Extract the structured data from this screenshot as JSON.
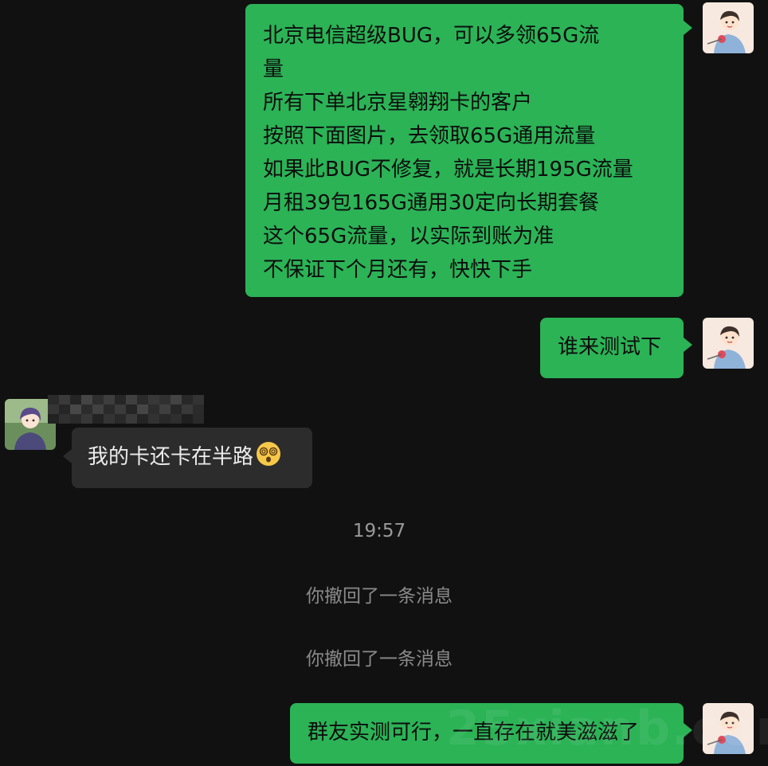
{
  "messages": [
    {
      "sender": "me",
      "lines": [
        "北京电信超级BUG，可以多领65G流",
        "量",
        "所有下单北京星翱翔卡的客户",
        "按照下面图片，去领取65G通用流量",
        "如果此BUG不修复，就是长期195G流量",
        "月租39包165G通用30定向长期套餐",
        "这个65G流量，以实际到账为准",
        "不保证下个月还有，快快下手"
      ]
    },
    {
      "sender": "me",
      "text": "谁来测试下"
    },
    {
      "sender": "other",
      "text": "我的卡还卡在半路",
      "emoji": "face-with-spiral-eyes-emoji"
    },
    {
      "sender": "me",
      "text": "群友实测可行，一直存在就美滋滋了"
    }
  ],
  "system": {
    "timestamp": "19:57",
    "recall_1": "你撤回了一条消息",
    "recall_2": "你撤回了一条消息"
  },
  "watermark": "25xianb.com",
  "colors": {
    "background": "#111111",
    "my_bubble": "#2bb356",
    "other_bubble": "#2c2c2c",
    "system_text": "#8a8a8a"
  }
}
